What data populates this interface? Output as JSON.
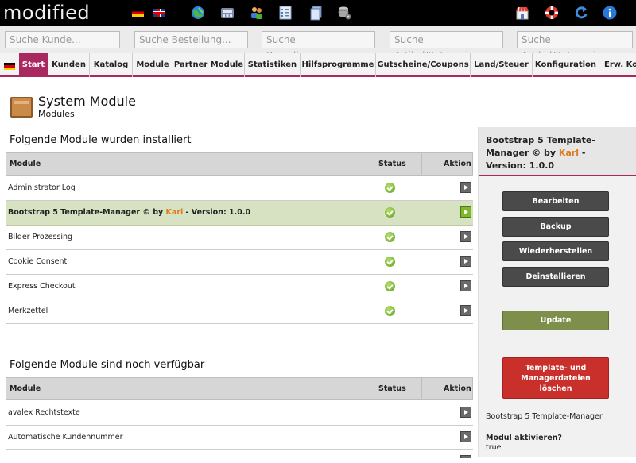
{
  "app": {
    "logo": "modified"
  },
  "search": {
    "customer": "Suche Kunde...",
    "order": "Suche Bestellung...",
    "order_number": "Suche Bestellnummer...",
    "article_category_1": "Suche Artikel/Kategorie...",
    "article_category_2": "Suche Artikel/Kategorie..."
  },
  "nav": {
    "items": [
      "Start",
      "Kunden",
      "Katalog",
      "Module",
      "Partner Module",
      "Statistiken",
      "Hilfsprogramme",
      "Gutscheine/Coupons",
      "Land/Steuer",
      "Konfiguration",
      "Erw. Ko"
    ]
  },
  "page": {
    "title": "System Module",
    "subtitle": "Modules"
  },
  "installed": {
    "heading": "Folgende Module wurden installiert",
    "col_module": "Module",
    "col_status": "Status",
    "col_action": "Aktion",
    "rows": [
      {
        "name": "Administrator Log"
      },
      {
        "name_pre": "Bootstrap 5 Template-Manager © by ",
        "author": "Karl",
        "name_post": " - Version: 1.0.0"
      },
      {
        "name": "Bilder Prozessing"
      },
      {
        "name": "Cookie Consent"
      },
      {
        "name": "Express Checkout"
      },
      {
        "name": "Merkzettel"
      }
    ]
  },
  "available": {
    "heading": "Folgende Module sind noch verfügbar",
    "col_module": "Module",
    "col_status": "Status",
    "col_action": "Aktion",
    "rows": [
      {
        "name": "avalex Rechtstexte"
      },
      {
        "name": "Automatische Kundennummer"
      }
    ]
  },
  "panel": {
    "title_pre": "Bootstrap 5 Template-Manager © by ",
    "author": "Karl",
    "title_post": " - Version: 1.0.0",
    "btn_edit": "Bearbeiten",
    "btn_backup": "Backup",
    "btn_restore": "Wiederherstellen",
    "btn_uninstall": "Deinstallieren",
    "btn_update": "Update",
    "btn_delete_l1": "Template- und",
    "btn_delete_l2": "Managerdateien",
    "btn_delete_l3": "löschen",
    "module_name": "Bootstrap 5 Template-Manager",
    "activate_label": "Modul aktivieren?",
    "activate_value": "true"
  },
  "colors": {
    "accent": "#a8285f",
    "selected_row": "#d6e2c1",
    "update": "#7d8f4a",
    "delete": "#c9302c"
  }
}
